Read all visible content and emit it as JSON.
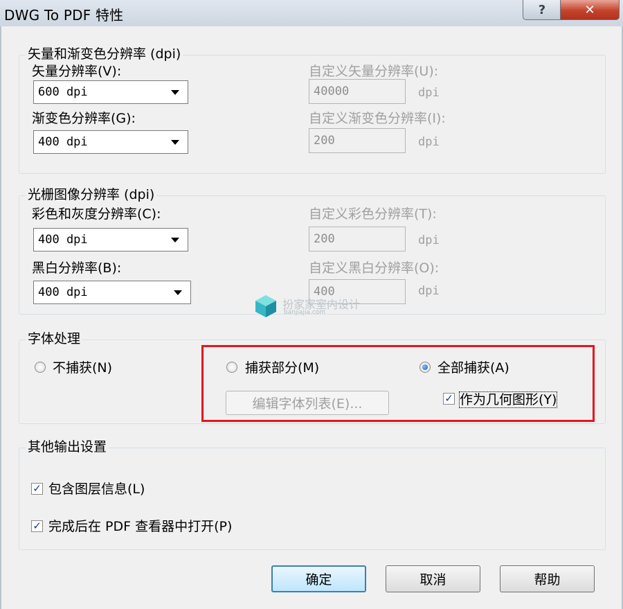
{
  "window": {
    "title": "DWG To PDF 特性",
    "help_glyph": "?",
    "close_glyph": "✕"
  },
  "vector": {
    "legend": "矢量和渐变色分辨率 (dpi)",
    "vector_label": "矢量分辨率(V):",
    "vector_value": "600 dpi",
    "gradient_label": "渐变色分辨率(G):",
    "gradient_value": "400 dpi",
    "custom_vector_label": "自定义矢量分辨率(U):",
    "custom_vector_value": "40000",
    "custom_gradient_label": "自定义渐变色分辨率(I):",
    "custom_gradient_value": "200",
    "unit": "dpi"
  },
  "raster": {
    "legend": "光栅图像分辨率 (dpi)",
    "color_label": "彩色和灰度分辨率(C):",
    "color_value": "400 dpi",
    "bw_label": "黑白分辨率(B):",
    "bw_value": "400 dpi",
    "custom_color_label": "自定义彩色分辨率(T):",
    "custom_color_value": "200",
    "custom_bw_label": "自定义黑白分辨率(O):",
    "custom_bw_value": "400",
    "unit": "dpi"
  },
  "font": {
    "legend": "字体处理",
    "no_capture": "不捕获(N)",
    "partial_capture": "捕获部分(M)",
    "full_capture": "全部捕获(A)",
    "edit_font_list": "编辑字体列表(E)...",
    "as_geometry": "作为几何图形(Y)",
    "selected": "full_capture",
    "as_geometry_checked": true
  },
  "other": {
    "legend": "其他输出设置",
    "include_layers": "包含图层信息(L)",
    "open_viewer": "完成后在 PDF 查看器中打开(P)",
    "include_layers_checked": true,
    "open_viewer_checked": true
  },
  "buttons": {
    "ok": "确定",
    "cancel": "取消",
    "help": "帮助"
  },
  "watermark": {
    "text": "扮家家室内设计",
    "sub": "banjiajia.com"
  },
  "colors": {
    "highlight": "#e8141b",
    "accent": "#3c7fb1"
  }
}
